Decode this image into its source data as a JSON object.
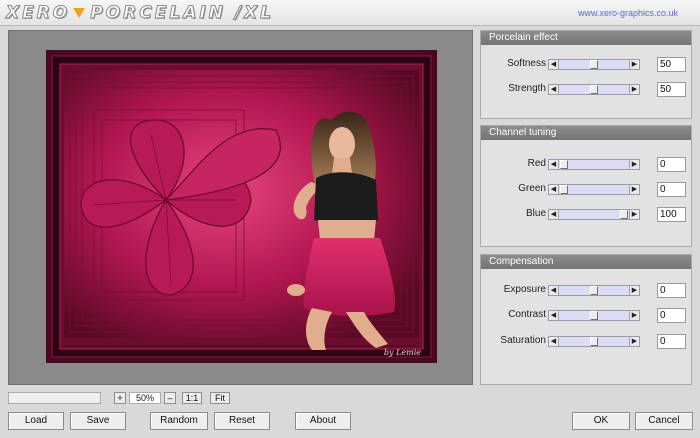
{
  "app": {
    "logo_left": "XERO",
    "logo_right": "PORCELAIN /XL",
    "website": "www.xero-graphics.co.uk"
  },
  "preview": {
    "signature": "by Lemie"
  },
  "panels": {
    "porcelain": {
      "title": "Porcelain effect",
      "controls": [
        {
          "label": "Softness",
          "value": "50",
          "level": 0.5
        },
        {
          "label": "Strength",
          "value": "50",
          "level": 0.5
        }
      ]
    },
    "channel": {
      "title": "Channel tuning",
      "controls": [
        {
          "label": "Red",
          "value": "0",
          "level": 0
        },
        {
          "label": "Green",
          "value": "0",
          "level": 0
        },
        {
          "label": "Blue",
          "value": "100",
          "level": 1
        }
      ]
    },
    "compensation": {
      "title": "Compensation",
      "controls": [
        {
          "label": "Exposure",
          "value": "0",
          "level": 0.5
        },
        {
          "label": "Contrast",
          "value": "0",
          "level": 0.5
        },
        {
          "label": "Saturation",
          "value": "0",
          "level": 0.5
        }
      ]
    }
  },
  "zoom": {
    "plus": "+",
    "value": "50%",
    "minus": "–",
    "one_to_one": "1:1",
    "fit": "Fit"
  },
  "buttons": {
    "load": "Load",
    "save": "Save",
    "random": "Random",
    "reset": "Reset",
    "about": "About",
    "ok": "OK",
    "cancel": "Cancel"
  },
  "colors": {
    "accent_magenta": "#c2185b",
    "slider_track": "#dcdcf4",
    "link": "#5b67e0",
    "logo_separator": "#f2a21a"
  },
  "icons": {
    "slider_left": "left-arrow-icon",
    "slider_right": "right-arrow-icon",
    "logo_separator": "down-triangle-icon"
  }
}
